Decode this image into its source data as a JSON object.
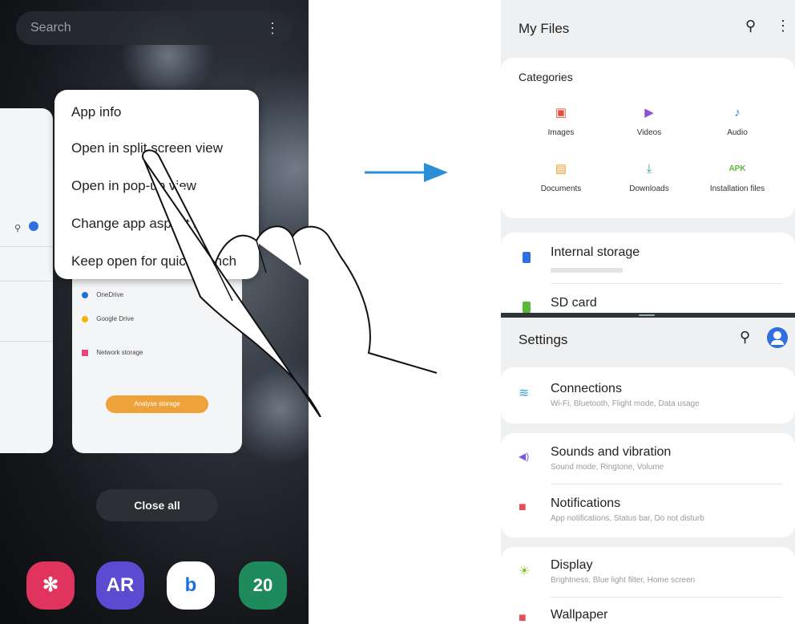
{
  "left_phone": {
    "search_placeholder": "Search",
    "more_glyph": "⋮",
    "context_menu": [
      {
        "label": "App info"
      },
      {
        "label": "Open in split screen view"
      },
      {
        "label": "Open in pop-up view"
      },
      {
        "label": "Change app aspect ratio"
      },
      {
        "label": "Keep open for quick launch"
      }
    ],
    "recent_card": {
      "items": [
        {
          "title": "OneDrive",
          "color": "#1e73c8"
        },
        {
          "title": "Google Drive",
          "color": "#f4b400"
        },
        {
          "title": "Network storage",
          "color": "#e0457b"
        }
      ],
      "button_label": "Analyse storage"
    },
    "close_all_label": "Close all",
    "dock": [
      {
        "label": "✻",
        "color": "#e0345f",
        "icon": "gallery-icon"
      },
      {
        "label": "AR",
        "color": "#5a4bd1",
        "icon": "ar-zone-icon"
      },
      {
        "label": "b",
        "color": "#ffffff",
        "icon": "bixby-icon"
      },
      {
        "label": "20",
        "color": "#1f8a5b",
        "icon": "calendar-icon"
      }
    ]
  },
  "arrow_color": "#2a8fd6",
  "right_phone": {
    "files": {
      "title": "My Files",
      "categories_heading": "Categories",
      "categories": [
        {
          "label": "Images",
          "glyph": "▣",
          "color": "#e0523f"
        },
        {
          "label": "Videos",
          "glyph": "▶",
          "color": "#8f4fd6"
        },
        {
          "label": "Audio",
          "glyph": "♪",
          "color": "#2f7fe0"
        },
        {
          "label": "Documents",
          "glyph": "▤",
          "color": "#ef9a2a"
        },
        {
          "label": "Downloads",
          "glyph": "⤓",
          "color": "#2aa7a0"
        },
        {
          "label": "Installation files",
          "glyph": "APK",
          "color": "#5cb83a"
        }
      ],
      "storage": [
        {
          "label": "Internal storage",
          "color": "#2f6fe0"
        },
        {
          "label": "SD card",
          "color": "#5cb83a"
        }
      ]
    },
    "settings": {
      "title": "Settings",
      "items": [
        {
          "title": "Connections",
          "subtitle": "Wi-Fi, Bluetooth, Flight mode, Data usage",
          "glyph": "≋",
          "color": "#3aa0e0"
        },
        {
          "title": "Sounds and vibration",
          "subtitle": "Sound mode, Ringtone, Volume",
          "glyph": "◀)",
          "color": "#7a5ad6"
        },
        {
          "title": "Notifications",
          "subtitle": "App notifications, Status bar, Do not disturb",
          "glyph": "■",
          "color": "#e0505a"
        },
        {
          "title": "Display",
          "subtitle": "Brightness, Blue light filter, Home screen",
          "glyph": "☀",
          "color": "#8ac43a"
        },
        {
          "title": "Wallpaper",
          "subtitle": "",
          "glyph": "■",
          "color": "#e0505a"
        }
      ]
    }
  }
}
